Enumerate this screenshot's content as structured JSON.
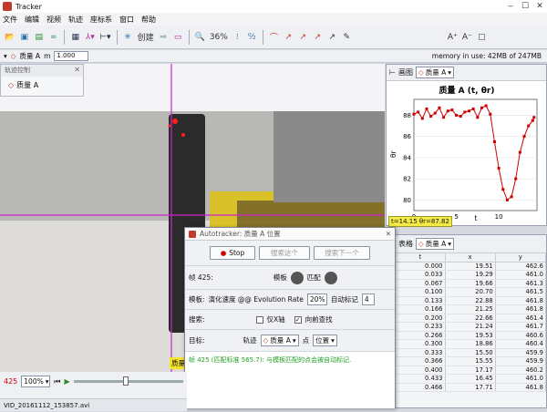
{
  "app": {
    "title": "Tracker"
  },
  "menu": [
    "文件",
    "编辑",
    "视频",
    "轨迹",
    "座标系",
    "窗口",
    "帮助"
  ],
  "toolbar": {
    "create_label": "创建",
    "zoom_label": "36%",
    "memory_label": "memory in use: 42MB of 247MB"
  },
  "row2": {
    "mass_name": "质量 A",
    "m_label": "m",
    "m_value": "1.000"
  },
  "track_control": {
    "title": "轨迹控制",
    "item": "质量 A"
  },
  "video_overlay": {
    "mass_tag": "质量"
  },
  "plot": {
    "dropdown": "质量 A",
    "tab_label": "画图",
    "title": "质量 A (t, θr)",
    "xlabel": "t",
    "ylabel": "θr",
    "readout": "t=14.15  θr=87.82"
  },
  "chart_data": {
    "type": "line",
    "title": "质量 A (t, θr)",
    "xlabel": "t",
    "ylabel": "θr",
    "xlim": [
      0,
      14.5
    ],
    "ylim": [
      79,
      89.5
    ],
    "x_ticks": [
      "0",
      "5",
      "10"
    ],
    "y_ticks": [
      "80",
      "82",
      "84",
      "86",
      "88"
    ],
    "series": [
      {
        "x": [
          0,
          0.5,
          1,
          1.5,
          2,
          2.5,
          3,
          3.5,
          4,
          4.5,
          5,
          5.5,
          6,
          6.5,
          7,
          7.5,
          8,
          8.5,
          9,
          9.5,
          10,
          10.5,
          11,
          11.5,
          12,
          12.5,
          13,
          13.5,
          14,
          14.15
        ],
        "y": [
          88.1,
          88.3,
          87.7,
          88.6,
          87.9,
          88.2,
          88.7,
          87.8,
          88.4,
          88.5,
          88.0,
          87.9,
          88.3,
          88.4,
          88.6,
          87.8,
          88.7,
          88.9,
          88.1,
          85.5,
          83.0,
          81.0,
          80.0,
          80.3,
          82.0,
          84.5,
          86.0,
          87.0,
          87.5,
          87.8
        ],
        "color": "#cc0000"
      }
    ]
  },
  "autotracker": {
    "title": "Autotracker: 质量 A 位置",
    "stop": "Stop",
    "search_this": "搜索这个",
    "search_next": "搜索下一个",
    "frame_label": "帧 425:",
    "template_label": "模板",
    "match_label": "匹配",
    "template_row_label": "模板:",
    "evolution_text": "演化速度 @@ Evolution Rate",
    "evolution_value": "20%",
    "auto_mark_label": "自动标记",
    "auto_mark_value": "4",
    "search_label": "搜索:",
    "x_axis_only": "仅X轴",
    "look_ahead": "向前查找",
    "target_label": "目标:",
    "track_label": "轨迹",
    "track_value": "质量 A",
    "point_label": "点",
    "point_value": "位置",
    "status_msg": "帧 425 (匹配标准 565.7): 与模板匹配的点会被自动标记."
  },
  "table": {
    "tab_label": "表格",
    "dropdown": "质量 A",
    "headers": [
      "t",
      "x",
      "y"
    ],
    "rows": [
      [
        "0.000",
        "19.51",
        "462.6"
      ],
      [
        "0.033",
        "19.29",
        "461.0"
      ],
      [
        "0.067",
        "19.66",
        "461.3"
      ],
      [
        "0.100",
        "20.70",
        "461.5"
      ],
      [
        "0.133",
        "22.88",
        "461.8"
      ],
      [
        "0.166",
        "21.25",
        "461.8"
      ],
      [
        "0.200",
        "22.66",
        "461.4"
      ],
      [
        "0.233",
        "21.24",
        "461.7"
      ],
      [
        "0.266",
        "19.53",
        "460.6"
      ],
      [
        "0.300",
        "18.86",
        "460.4"
      ],
      [
        "0.333",
        "15.50",
        "459.9"
      ],
      [
        "0.366",
        "15.55",
        "459.9"
      ],
      [
        "0.400",
        "17.17",
        "460.2"
      ],
      [
        "0.433",
        "16.45",
        "461.0"
      ],
      [
        "0.466",
        "17.71",
        "461.8"
      ]
    ]
  },
  "status": {
    "frame": "425",
    "zoom": "100%",
    "filename": "VID_20161112_153857.avi"
  },
  "icons": [
    "new-file-icon",
    "save-icon",
    "open-icon",
    "video-icon",
    "axes-icon",
    "ruler-icon",
    "create-icon",
    "tape-icon",
    "zoom-icon",
    "calibration-icon",
    "angle-icon",
    "track-point-icon",
    "font-size-icon",
    "play-icon",
    "stop-icon"
  ]
}
